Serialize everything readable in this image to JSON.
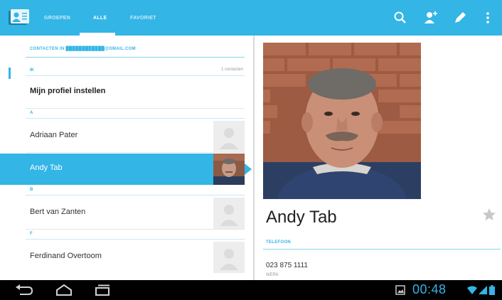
{
  "colors": {
    "accent": "#33b5e5",
    "selected": "#33b5e5",
    "system_bar": "#000000",
    "clock": "#33b5e5"
  },
  "action_bar": {
    "tabs": [
      {
        "label": "GROEPEN",
        "active": false
      },
      {
        "label": "ALLE",
        "active": true
      },
      {
        "label": "FAVORIET",
        "active": false
      }
    ],
    "icons": [
      "search-icon",
      "add-contact-icon",
      "edit-icon",
      "overflow-menu-icon"
    ]
  },
  "contact_list": {
    "account_header": "CONTACTEN IN ████████████@GMAIL.COM",
    "sections": [
      {
        "letter": "IK",
        "count": "1 contacten"
      },
      {
        "letter": "A"
      },
      {
        "letter": "B"
      },
      {
        "letter": "F"
      }
    ],
    "rows": [
      {
        "name": "Mijn profiel instellen"
      },
      {
        "name": "Adriaan Pater"
      },
      {
        "name": "Andy Tab"
      },
      {
        "name": "Bert van Zanten"
      },
      {
        "name": "Ferdinand Overtoom"
      }
    ]
  },
  "detail": {
    "name": "Andy Tab",
    "phone_header": "TELEFOON",
    "phone_number": "023 875 1111",
    "phone_type": "WERK"
  },
  "system_bar": {
    "clock": "00:48",
    "icons": [
      "back-icon",
      "home-icon",
      "recent-apps-icon",
      "gallery-notification-icon",
      "wifi-icon",
      "signal-icon",
      "battery-icon"
    ]
  }
}
